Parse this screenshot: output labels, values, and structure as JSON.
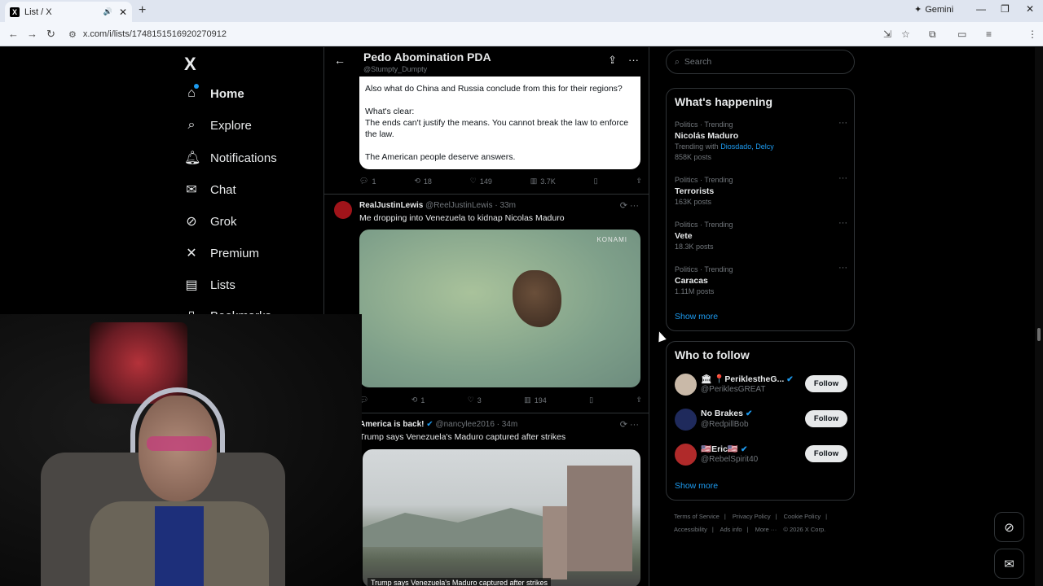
{
  "browser": {
    "tab_title": "List / X",
    "tab_favicon": "X",
    "new_tab_label": "+",
    "gemini_label": "Gemini",
    "url": "x.com/i/lists/1748151516920270912"
  },
  "nav": {
    "logo": "X",
    "items": [
      {
        "label": "Home",
        "icon": "home-icon"
      },
      {
        "label": "Explore",
        "icon": "search-icon"
      },
      {
        "label": "Notifications",
        "icon": "bell-icon"
      },
      {
        "label": "Chat",
        "icon": "mail-icon"
      },
      {
        "label": "Grok",
        "icon": "grok-icon"
      },
      {
        "label": "Premium",
        "icon": "x-icon"
      },
      {
        "label": "Lists",
        "icon": "list-icon"
      },
      {
        "label": "Bookmarks",
        "icon": "bookmark-icon"
      }
    ]
  },
  "list_header": {
    "title": "Pedo Abomination PDA",
    "handle": "@Stumpty_Dumpty"
  },
  "quote": {
    "line1": "Also what do China and Russia conclude from this for their regions?",
    "line2": "What's clear:",
    "line3": "The ends can't justify the means. You cannot break the law to enforce the law.",
    "line4": "The American people deserve answers."
  },
  "tweet0_actions": {
    "replies": "1",
    "retweets": "18",
    "likes": "149",
    "views": "3.7K"
  },
  "tweet1": {
    "name": "RealJustinLewis",
    "handle": "@ReelJustinLewis",
    "time": "· 33m",
    "text": "Me dropping into Venezuela to kidnap Nicolas Maduro",
    "media_watermark": "KONAMI",
    "actions": {
      "replies": "",
      "retweets": "1",
      "likes": "3",
      "views": "194"
    }
  },
  "tweet2": {
    "name": "America is back!",
    "handle": "@nancylee2016",
    "time": "· 34m",
    "text": "Trump says Venezuela's Maduro captured after strikes",
    "media_caption": "Trump says Venezuela's Maduro captured after strikes"
  },
  "search": {
    "placeholder": "Search"
  },
  "happening": {
    "title": "What's happening",
    "trends": [
      {
        "category": "Politics · Trending",
        "name": "Nicolás Maduro",
        "with_label": "Trending with",
        "with_links": "Diosdado, Delcy",
        "posts": "858K posts"
      },
      {
        "category": "Politics · Trending",
        "name": "Terrorists",
        "posts": "163K posts"
      },
      {
        "category": "Politics · Trending",
        "name": "Vete",
        "posts": "18.3K posts"
      },
      {
        "category": "Politics · Trending",
        "name": "Caracas",
        "posts": "1.11M posts"
      }
    ],
    "show_more": "Show more"
  },
  "who_to_follow": {
    "title": "Who to follow",
    "accounts": [
      {
        "name": "🏛 📍PeriklestheG...",
        "handle": "@PeriklesGREAT",
        "follow": "Follow",
        "avatar_color": "#c9b9a8"
      },
      {
        "name": "No Brakes",
        "handle": "@RedpillBob",
        "follow": "Follow",
        "avatar_color": "#1f2a5c"
      },
      {
        "name": "🇺🇸Eric🇺🇸",
        "handle": "@RebelSpirit40",
        "follow": "Follow",
        "avatar_color": "#b02a2a"
      }
    ],
    "show_more": "Show more"
  },
  "footer": {
    "links": [
      "Terms of Service",
      "Privacy Policy",
      "Cookie Policy",
      "Accessibility",
      "Ads info",
      "More ···"
    ],
    "copyright": "© 2026 X Corp."
  }
}
